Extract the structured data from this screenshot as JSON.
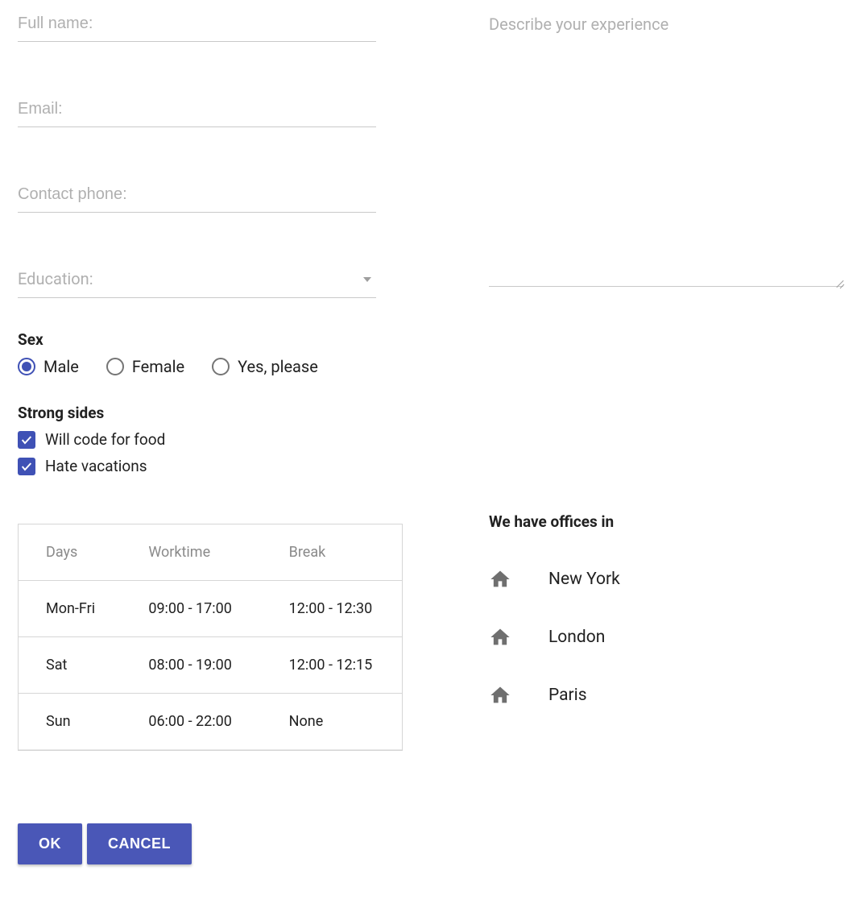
{
  "inputs": {
    "fullname_placeholder": "Full name:",
    "email_placeholder": "Email:",
    "phone_placeholder": "Contact phone:",
    "education_placeholder": "Education:",
    "experience_placeholder": "Describe your experience"
  },
  "sex": {
    "label": "Sex",
    "options": [
      {
        "label": "Male",
        "selected": true
      },
      {
        "label": "Female",
        "selected": false
      },
      {
        "label": "Yes, please",
        "selected": false
      }
    ]
  },
  "strong_sides": {
    "label": "Strong sides",
    "items": [
      {
        "label": "Will code for food",
        "checked": true
      },
      {
        "label": "Hate vacations",
        "checked": true
      }
    ]
  },
  "schedule": {
    "headers": [
      "Days",
      "Worktime",
      "Break"
    ],
    "rows": [
      [
        "Mon-Fri",
        "09:00 - 17:00",
        "12:00 - 12:30"
      ],
      [
        "Sat",
        "08:00 - 19:00",
        "12:00 - 12:15"
      ],
      [
        "Sun",
        "06:00 - 22:00",
        "None"
      ]
    ]
  },
  "offices": {
    "title": "We have offices in",
    "cities": [
      "New York",
      "London",
      "Paris"
    ]
  },
  "buttons": {
    "ok": "OK",
    "cancel": "CANCEL"
  }
}
